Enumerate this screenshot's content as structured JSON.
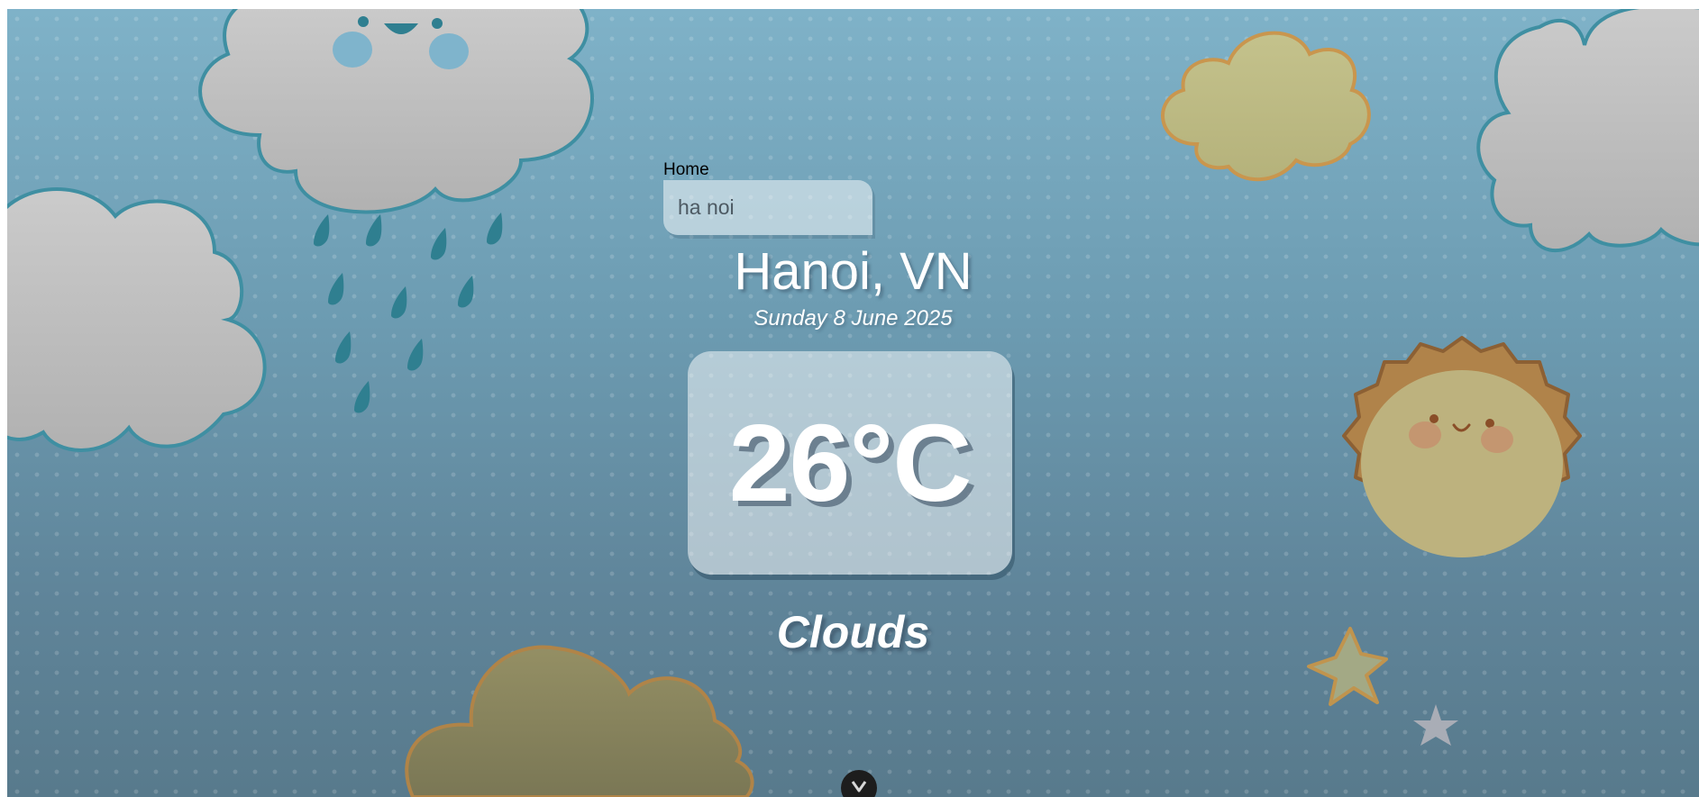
{
  "nav": {
    "home_label": "Home"
  },
  "search": {
    "value": "ha noi"
  },
  "weather": {
    "location": "Hanoi, VN",
    "date": "Sunday 8 June 2025",
    "temperature": "26°C",
    "condition": "Clouds"
  },
  "icons": {
    "scroll_down": "chevron-down-icon",
    "decorations": [
      "rain-cloud-icon",
      "cloud-icon",
      "sun-icon",
      "star-icon"
    ]
  },
  "colors": {
    "sky_top": "#7fb2c8",
    "sky_bottom": "#587a8c",
    "cloud_gray": "#c2c2c2",
    "cloud_outline": "#3f8fa2",
    "rain_drop": "#2f7f90",
    "sun_outer": "#b0834a",
    "sun_inner": "#bfb57a",
    "yellow_cloud": "#c0bb85",
    "text_primary": "#ffffff"
  }
}
